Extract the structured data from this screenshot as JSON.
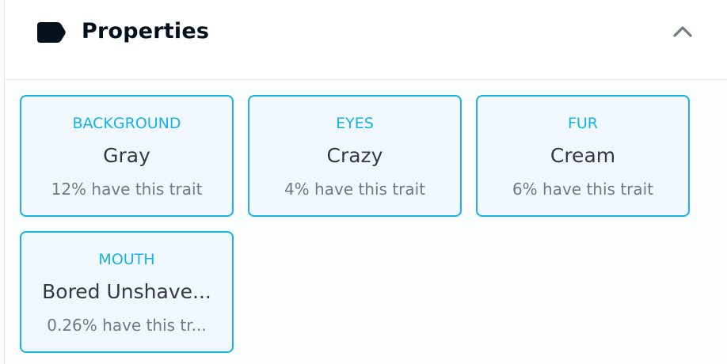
{
  "section": {
    "title": "Properties",
    "tag_icon": "tag-icon",
    "collapse_icon": "chevron-up-icon"
  },
  "colors": {
    "accent": "#15b2e5",
    "card_bg": "#f1f8fd",
    "title": "#04111d",
    "value": "#353840",
    "muted": "#707a83"
  },
  "properties": [
    {
      "type": "BACKGROUND",
      "value": "Gray",
      "rarity": "12% have this trait"
    },
    {
      "type": "EYES",
      "value": "Crazy",
      "rarity": "4% have this trait"
    },
    {
      "type": "FUR",
      "value": "Cream",
      "rarity": "6% have this trait"
    },
    {
      "type": "MOUTH",
      "value": "Bored Unshave...",
      "rarity": "0.26% have this tr..."
    }
  ]
}
